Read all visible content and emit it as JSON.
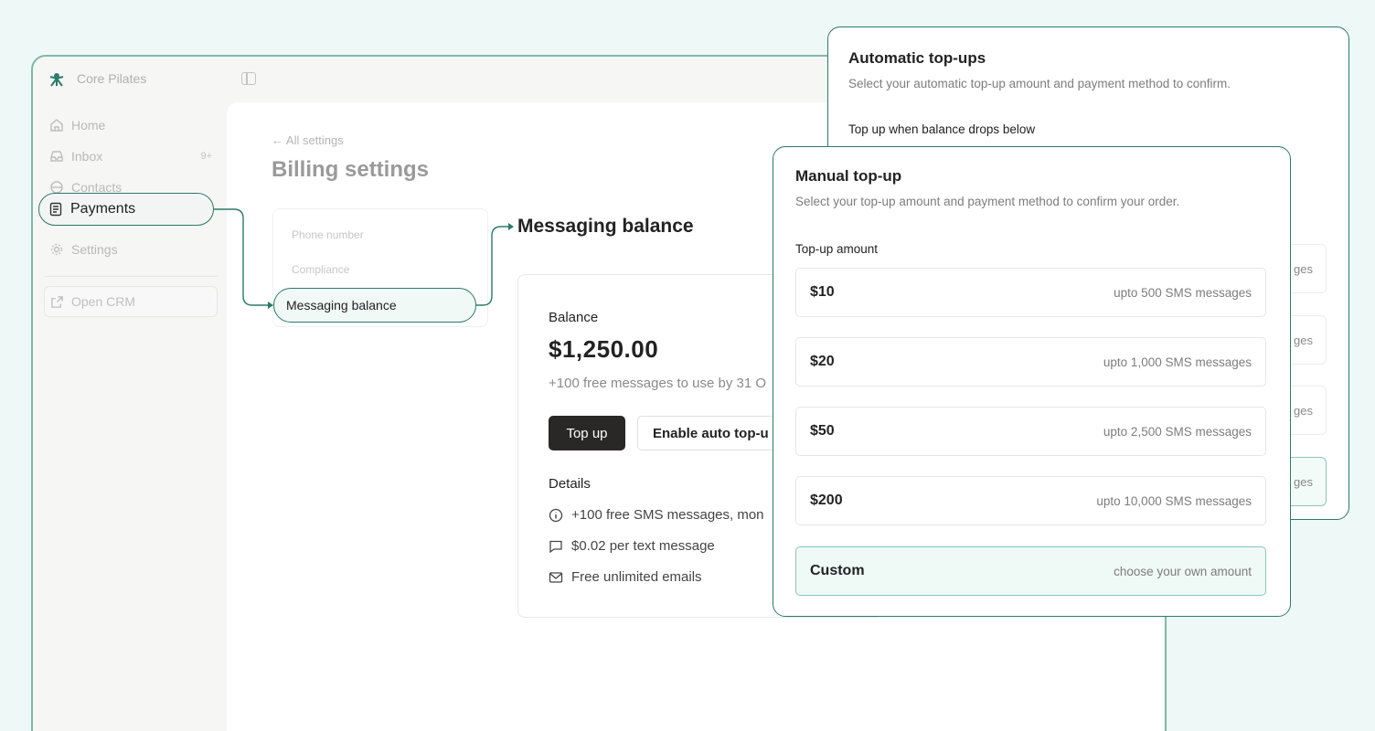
{
  "brand": {
    "name": "Core Pilates"
  },
  "sidebar": {
    "items": [
      {
        "label": "Home",
        "icon": "home-icon"
      },
      {
        "label": "Inbox",
        "icon": "inbox-icon",
        "count": "9+"
      },
      {
        "label": "Contacts",
        "icon": "contacts-icon"
      },
      {
        "label": "Payments",
        "icon": "receipt-icon"
      },
      {
        "label": "Settings",
        "icon": "gear-icon"
      }
    ],
    "open_crm": "Open CRM"
  },
  "page": {
    "back_link": "← All settings",
    "title": "Billing settings"
  },
  "settings_nav": {
    "items": [
      "Phone number",
      "Compliance",
      "Messaging balance"
    ]
  },
  "messaging": {
    "section_title": "Messaging balance",
    "balance_label": "Balance",
    "balance_amount": "$1,250.00",
    "free_note": "+100 free messages to use by 31 O",
    "top_up_label": "Top up",
    "auto_top_up_label": "Enable auto top-u",
    "details_title": "Details",
    "details": [
      {
        "icon": "info-icon",
        "text": "+100 free SMS messages, mon"
      },
      {
        "icon": "message-icon",
        "text": "$0.02 per text message"
      },
      {
        "icon": "mail-icon",
        "text": "Free unlimited emails"
      }
    ]
  },
  "auto_topups": {
    "title": "Automatic top-ups",
    "subtitle": "Select your automatic top-up amount and payment method to confirm.",
    "threshold_label": "Top up when balance drops below",
    "option_suffixes": [
      "ges",
      "ges",
      "ges",
      "ges"
    ]
  },
  "manual_topup": {
    "title": "Manual top-up",
    "subtitle": "Select your top-up amount and payment method to confirm your order.",
    "amount_label": "Top-up amount",
    "options": [
      {
        "price": "$10",
        "desc": "upto 500 SMS messages"
      },
      {
        "price": "$20",
        "desc": "upto 1,000 SMS messages"
      },
      {
        "price": "$50",
        "desc": "upto 2,500 SMS messages"
      },
      {
        "price": "$200",
        "desc": "upto 10,000 SMS messages"
      },
      {
        "price": "Custom",
        "desc": "choose your own amount"
      }
    ]
  },
  "colors": {
    "accent": "#2c7a68",
    "background": "#eef8f6",
    "primary_button": "#2a2727"
  }
}
